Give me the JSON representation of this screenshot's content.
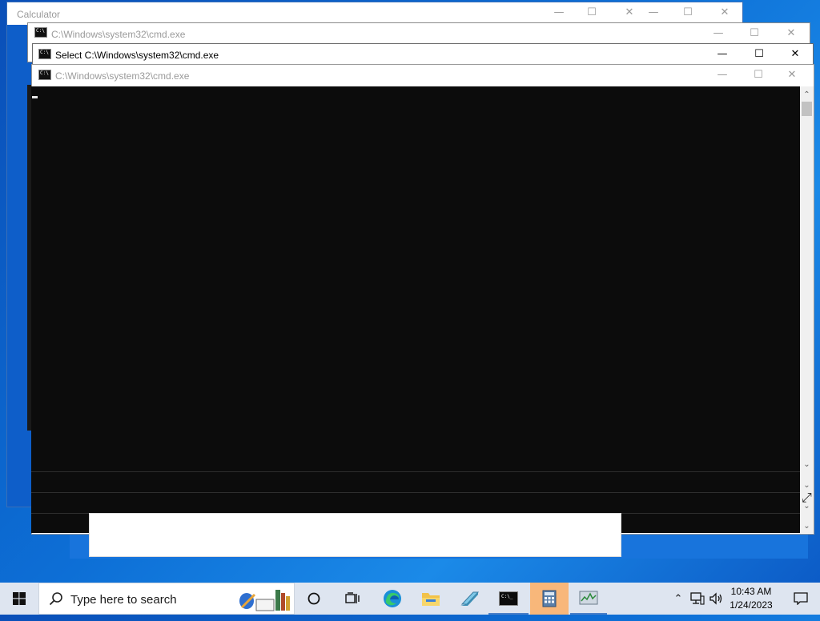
{
  "windows": {
    "calculator": {
      "title": "Calculator"
    },
    "cmd_back": {
      "title": "C:\\Windows\\system32\\cmd.exe"
    },
    "cmd_select": {
      "title": "Select C:\\Windows\\system32\\cmd.exe"
    },
    "cmd_front": {
      "title": "C:\\Windows\\system32\\cmd.exe"
    }
  },
  "controls": {
    "minimize": "—",
    "maximize": "☐",
    "close": "✕"
  },
  "taskbar": {
    "search_placeholder": "Type here to search",
    "time": "10:43 AM",
    "date": "1/24/2023",
    "apps": [
      "edge-icon",
      "file-explorer-icon",
      "notepad-icon",
      "cmd-icon",
      "calculator-icon",
      "task-manager-icon"
    ],
    "active_app": "calculator-icon"
  },
  "colors": {
    "console_bg": "#0c0c0c",
    "taskbar_bg": "#dee5f0",
    "active_app_highlight": "#f8b77a",
    "desktop_blue": "#0d6fd6"
  }
}
